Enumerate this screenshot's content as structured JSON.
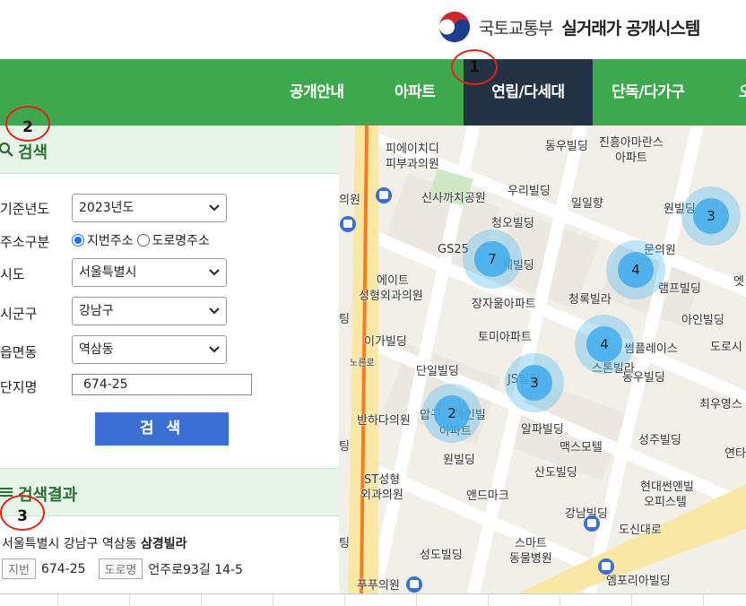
{
  "header": {
    "ministry": "국토교통부",
    "system_title": "실거래가 공개시스템"
  },
  "nav": {
    "items": [
      {
        "label": "공개안내"
      },
      {
        "label": "아파트"
      },
      {
        "label": "연립/다세대",
        "active": true
      },
      {
        "label": "단독/다가구"
      },
      {
        "label": "오"
      }
    ]
  },
  "markers": [
    "1",
    "2",
    "3"
  ],
  "search": {
    "title": "검색",
    "year_label": "기준년도",
    "year_value": "2023년도",
    "addr_type_label": "주소구분",
    "addr_opt_lot": "지번주소",
    "addr_opt_road": "도로명주소",
    "sido_label": "시도",
    "sido_value": "서울특별시",
    "sigungu_label": "시군구",
    "sigungu_value": "강남구",
    "dong_label": "읍면동",
    "dong_value": "역삼동",
    "complex_label": "단지명",
    "complex_value": "674-25",
    "button": "검 색"
  },
  "results": {
    "title": "검색결과",
    "address_prefix": "서울특별시 강남구 역삼동",
    "building": "삼경빌라",
    "lot_tag": "지번",
    "lot_value": "674-25",
    "road_tag": "도로명",
    "road_value": "언주로93길 14-5"
  },
  "map": {
    "labels": [
      "피에이치디",
      "피부과의원",
      "동우빌딩",
      "진흥아마란스",
      "아파트",
      "신사까치공원",
      "우리빌딩",
      "일일향",
      "원빌딩",
      "청오빌딩",
      "GS25",
      "세빌딩",
      "문의원",
      "에이트",
      "성형외과의원",
      "장자울아파트",
      "청록빌라",
      "램프빌딩",
      "엣",
      "아인빌딩",
      "이가빌딩",
      "토미아파트",
      "썸플레이스",
      "도로시",
      "단일빌딩",
      "JS빌딩",
      "스톤빌라",
      "동우빌딩",
      "반하다의원",
      "압구",
      "아인빌",
      "아파트",
      "알파빌딩",
      "최우영스",
      "맥스모텔",
      "성주빌딩",
      "원빌딩",
      "연타",
      "ST성형",
      "외과의원",
      "산도빌딩",
      "앤드마크",
      "현대썬앤빌",
      "오피스텔",
      "강남빌딩",
      "도신대로",
      "스마트",
      "동물병원",
      "성도빌딩",
      "엠포리아빌딩",
      "의원",
      "팅",
      "팅",
      "팅",
      "노른로",
      "푸푸의원"
    ],
    "clusters": [
      7,
      4,
      3,
      4,
      3,
      2
    ]
  }
}
